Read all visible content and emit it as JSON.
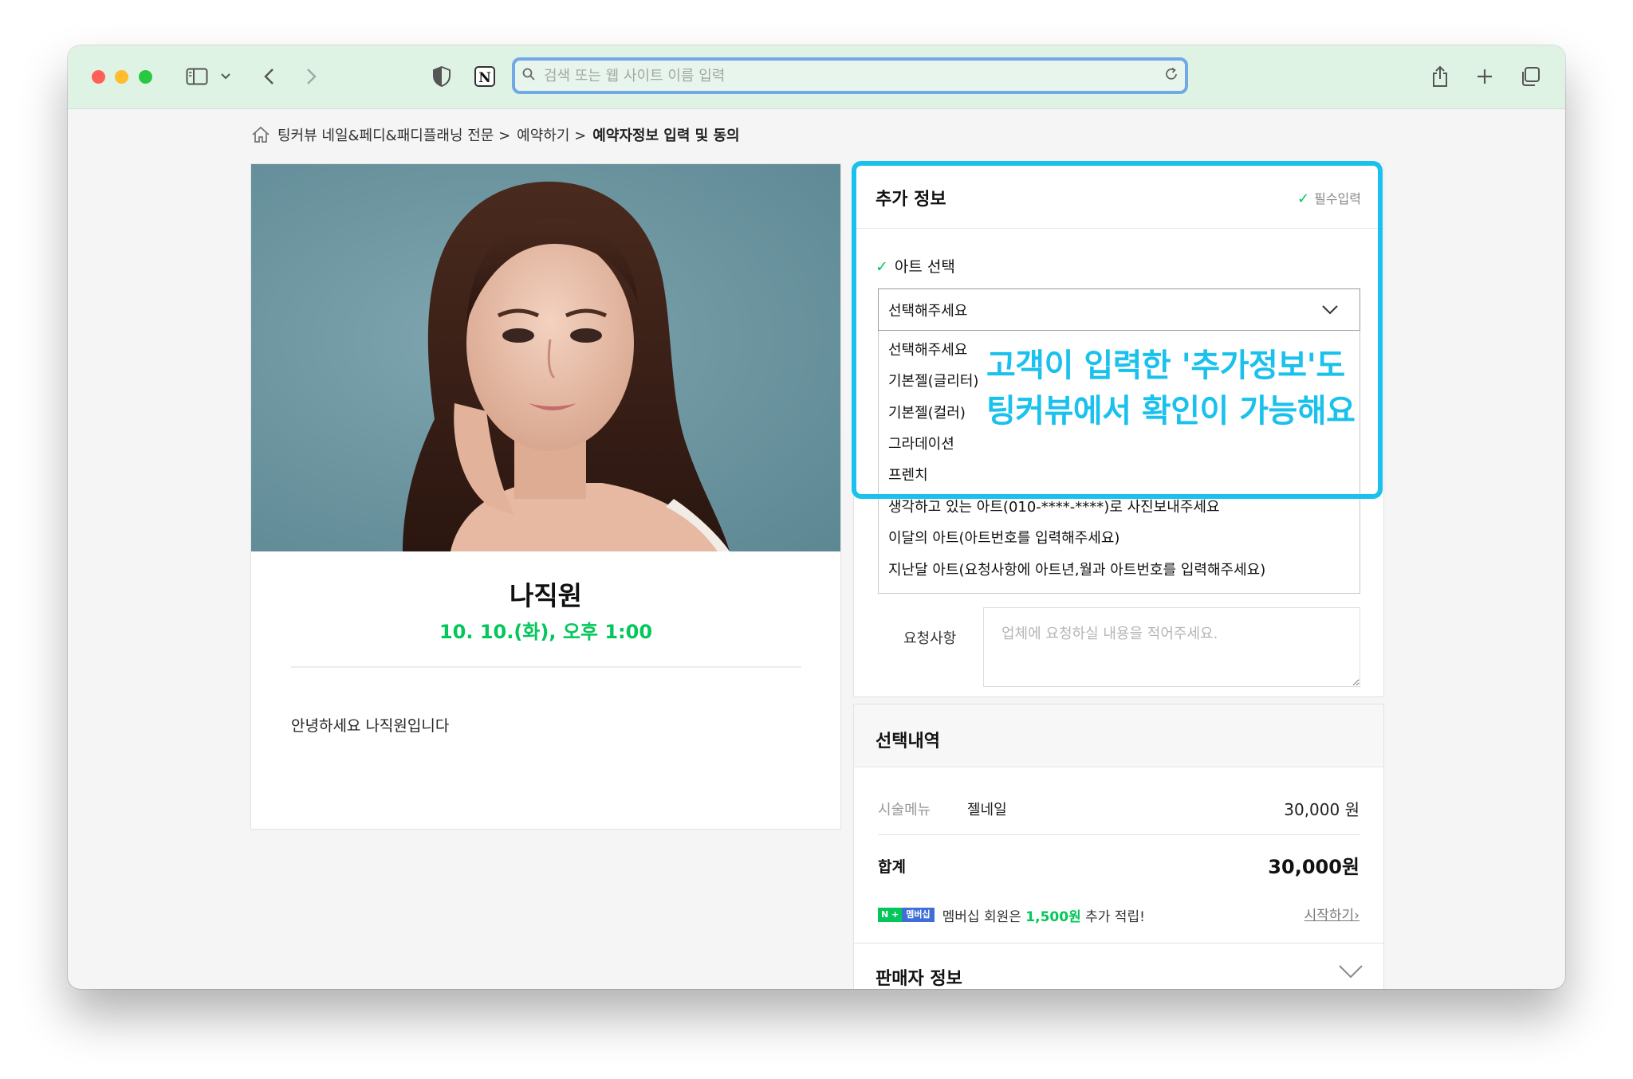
{
  "browser": {
    "url_placeholder": "검색 또는 웹 사이트 이름 입력"
  },
  "breadcrumb": {
    "items": [
      "팅커뷰 네일&페디&패디플래닝 전문 >",
      "예약하기 >",
      "예약자정보 입력 및 동의"
    ]
  },
  "booking": {
    "staff_name": "나직원",
    "datetime": "10. 10.(화), 오후 1:00",
    "greeting": "안녕하세요 나직원입니다"
  },
  "additional_info": {
    "title": "추가 정보",
    "required_note": "필수입력",
    "art_label": "아트 선택",
    "selected": "선택해주세요",
    "options": [
      "선택해주세요",
      "기본젤(글리터)",
      "기본젤(컬러)",
      "그라데이션",
      "프렌치",
      "생각하고 있는 아트(010-****-****)로 사진보내주세요",
      "이달의 아트(아트번호를 입력해주세요)",
      "지난달 아트(요청사항에 아트년,월과 아트번호를 입력해주세요)"
    ],
    "request_label": "요청사항",
    "request_placeholder": "업체에 요청하실 내용을 적어주세요."
  },
  "callout": {
    "line1": "고객이 입력한 '추가정보'도",
    "line2": "팅커뷰에서 확인이 가능해요"
  },
  "summary": {
    "title": "선택내역",
    "menu_label": "시술메뉴",
    "menu_name": "젤네일",
    "menu_price": "30,000 원",
    "total_label": "합계",
    "total_value": "30,000원",
    "badge_n": "N +",
    "badge_m": "멤버십",
    "member_prefix": "멤버십 회원은",
    "member_points": "1,500원",
    "member_suffix": "추가 적립!",
    "start_link": "시작하기›"
  },
  "seller": {
    "title": "판매자 정보"
  },
  "colors": {
    "accent_green": "#03c75a",
    "highlight_blue": "#19c1ec",
    "titlebar": "#dff3e4"
  }
}
